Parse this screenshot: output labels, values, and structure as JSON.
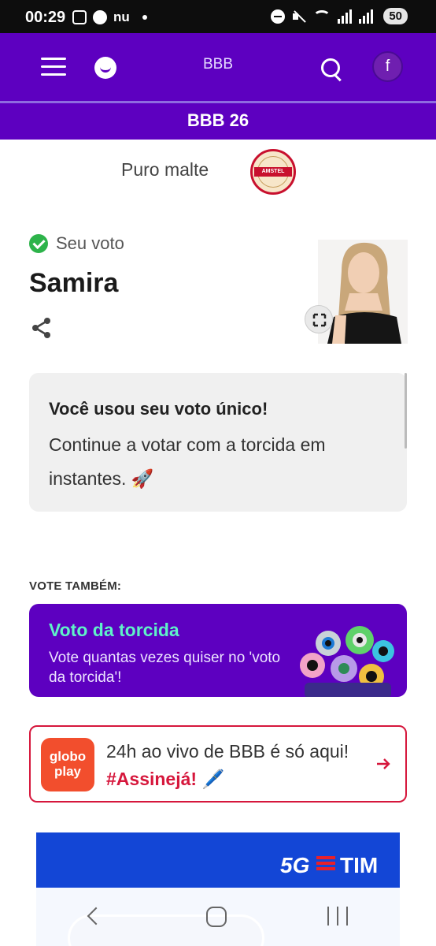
{
  "status_bar": {
    "time": "00:29",
    "carrier_icon_text": "nu",
    "battery": "50"
  },
  "app_header": {
    "title": "BBB",
    "avatar_initial": "f",
    "menu_icon": "hamburger-menu-icon",
    "logo_icon": "smile-logo-icon",
    "search_icon": "search-icon"
  },
  "subheader": {
    "title": "BBB 26"
  },
  "sponsor": {
    "text": "Puro malte",
    "logo_text": "AMSTEL",
    "logo_color": "#c8102e"
  },
  "vote": {
    "status_label": "Seu voto",
    "candidate": "Samira",
    "share_icon": "share-icon",
    "expand_icon": "expand-icon"
  },
  "info_card": {
    "bold": "Você usou seu voto único!",
    "body": "Continue a votar com a torcida em instantes. 🚀"
  },
  "vote_also": {
    "section_label": "VOTE TAMBÉM:",
    "card_title": "Voto da torcida",
    "card_desc": "Vote quantas vezes quiser no 'voto da torcida'!",
    "title_color": "#5ff2c8"
  },
  "globoplay": {
    "logo_line1": "globo",
    "logo_line2": "play",
    "text_prefix": "24h ao vivo de BBB é só aqui! ",
    "hashtag": "#Assinejá!",
    "emoji": "🖊️",
    "accent": "#d6173c"
  },
  "ad": {
    "badge": "5G",
    "brand": "TIM"
  },
  "colors": {
    "primary": "#5d00c0",
    "success": "#2db34a"
  }
}
